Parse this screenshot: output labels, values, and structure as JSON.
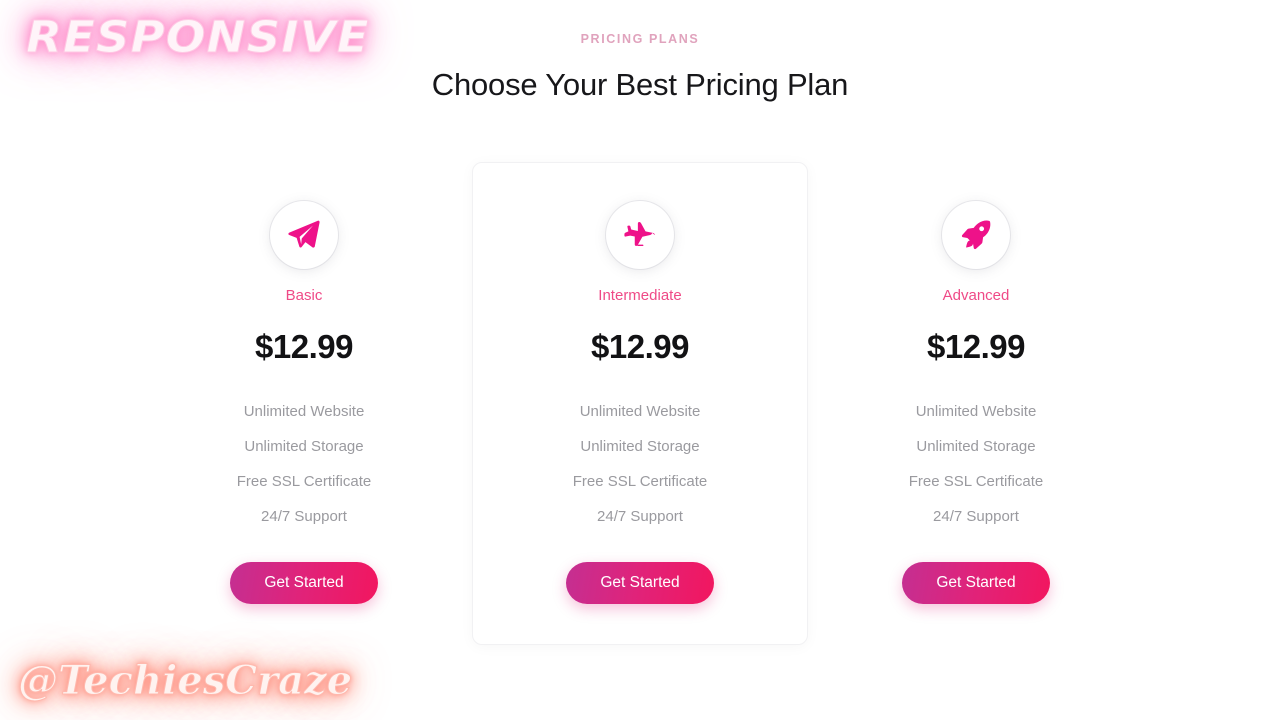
{
  "header": {
    "eyebrow": "PRICING PLANS",
    "headline": "Choose Your Best Pricing Plan"
  },
  "colors": {
    "accent_pink": "#ef4a87",
    "eyebrow_pink": "#e0a3bd",
    "icon_pink": "#ee1289",
    "price_dark": "#121214",
    "feature_gray": "#9a9a9f",
    "button_gradient_start": "#c42f92",
    "button_gradient_end": "#f2165f",
    "card_border": "#f1f1f3",
    "page_background": "#ffffff"
  },
  "plans": [
    {
      "icon": "paper-plane-icon",
      "name": "Basic",
      "price": "$12.99",
      "featured": false,
      "features": [
        "Unlimited Website",
        "Unlimited Storage",
        "Free SSL Certificate",
        "24/7 Support"
      ],
      "cta_label": "Get Started"
    },
    {
      "icon": "airplane-icon",
      "name": "Intermediate",
      "price": "$12.99",
      "featured": true,
      "features": [
        "Unlimited Website",
        "Unlimited Storage",
        "Free SSL Certificate",
        "24/7 Support"
      ],
      "cta_label": "Get Started"
    },
    {
      "icon": "rocket-icon",
      "name": "Advanced",
      "price": "$12.99",
      "featured": false,
      "features": [
        "Unlimited Website",
        "Unlimited Storage",
        "Free SSL Certificate",
        "24/7 Support"
      ],
      "cta_label": "Get Started"
    }
  ],
  "watermarks": {
    "top_left": "RESPONSIVE",
    "bottom_left": "@TechiesCraze"
  }
}
